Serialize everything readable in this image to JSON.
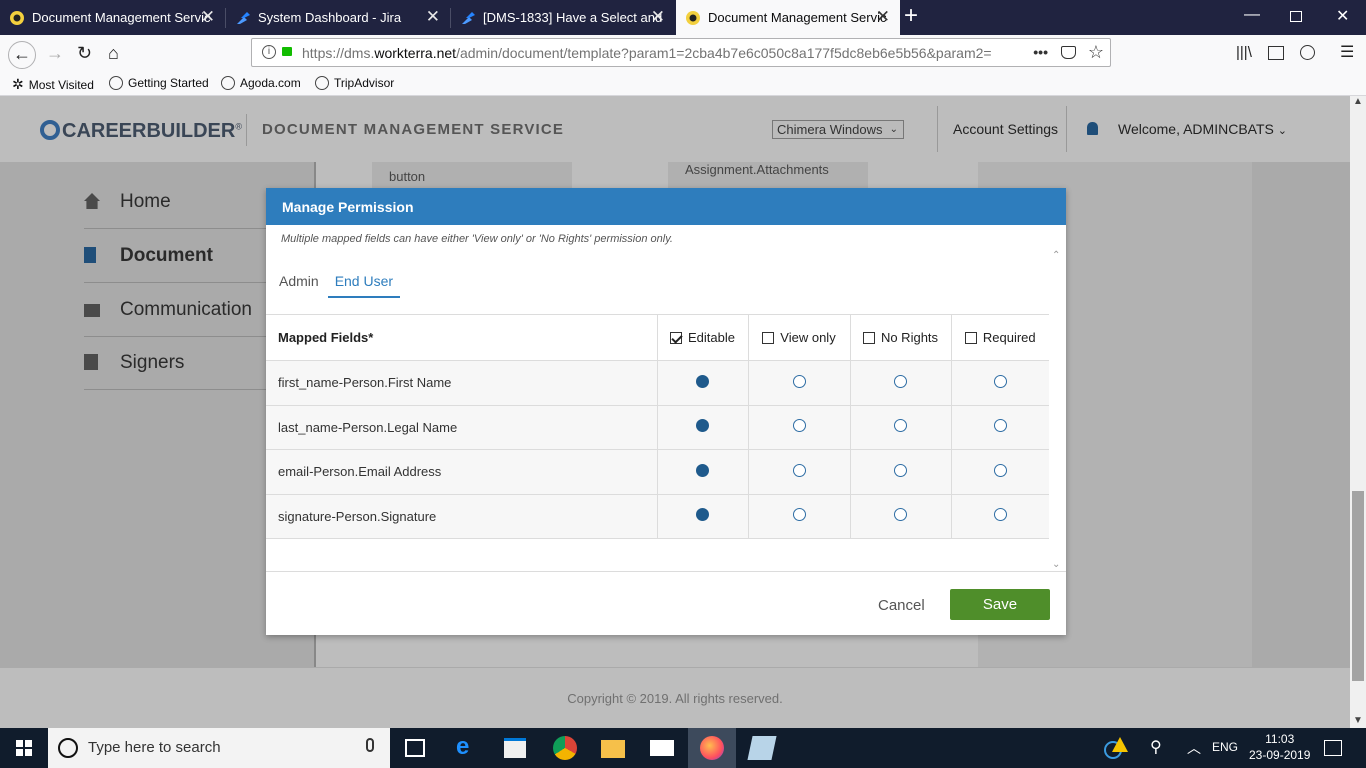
{
  "browser": {
    "tabs": [
      {
        "title": "Document Management Servic"
      },
      {
        "title": "System Dashboard - Jira"
      },
      {
        "title": "[DMS-1833] Have a Select and"
      },
      {
        "title": "Document Management Servic"
      }
    ],
    "url_prefix": "https://dms.",
    "url_domain": "workterra.net",
    "url_path": "/admin/document/template?param1=2cba4b7e6c050c8a177f5dc8eb6e5b56&param2=",
    "bookmarks": [
      "Most Visited",
      "Getting Started",
      "Agoda.com",
      "TripAdvisor"
    ]
  },
  "app": {
    "logo": "CAREERBUILDER",
    "logo_reg": "®",
    "name": "DOCUMENT MANAGEMENT SERVICE",
    "org_select": "Chimera Windows",
    "account_settings": "Account Settings",
    "welcome": "Welcome, ADMINCBATS",
    "sidebar": [
      "Home",
      "Document",
      "Communication",
      "Signers"
    ],
    "bg_button": "button",
    "bg_assign": "Assignment.Attachments",
    "footer": "Copyright © 2019. All rights reserved."
  },
  "modal": {
    "title": "Manage Permission",
    "note": "Multiple mapped fields can have either 'View only' or 'No Rights' permission only.",
    "tabs": [
      "Admin",
      "End User"
    ],
    "active_tab": "End User",
    "columns": {
      "field": "Mapped Fields*",
      "editable": "Editable",
      "view_only": "View only",
      "no_rights": "No Rights",
      "required": "Required"
    },
    "rows": [
      {
        "field": "first_name-Person.First Name",
        "selected": "Editable"
      },
      {
        "field": "last_name-Person.Legal Name",
        "selected": "Editable"
      },
      {
        "field": "email-Person.Email Address",
        "selected": "Editable"
      },
      {
        "field": "signature-Person.Signature",
        "selected": "Editable"
      }
    ],
    "cancel": "Cancel",
    "save": "Save"
  },
  "taskbar": {
    "search_placeholder": "Type here to search",
    "lang": "ENG",
    "time": "11:03",
    "date": "23-09-2019"
  },
  "colors": {
    "modal_header": "#2e7dbd",
    "save_button": "#4f8e2a",
    "radio_selected": "#1f5a8c"
  }
}
